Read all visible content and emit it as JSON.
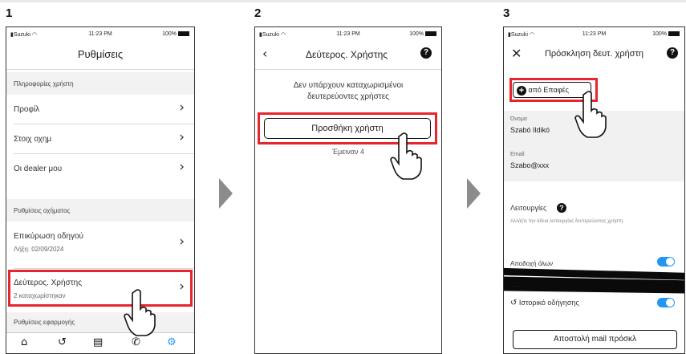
{
  "steps": [
    {
      "number": "1"
    },
    {
      "number": "2"
    },
    {
      "number": "3"
    }
  ],
  "status_bar": {
    "carrier": "Suzuki",
    "time": "11:23 PM",
    "battery": "100%"
  },
  "screen1": {
    "title": "Ρυθμίσεις",
    "section_user_info": "Πληροφορίες χρήστη",
    "profile": "Προφίλ",
    "vehicle_info": "Στοιχ οχημ",
    "my_dealers": "Οι dealer μου",
    "section_vehicle_settings": "Ρυθμίσεις οχήματος",
    "driver_verification": "Επικύρωση οδηγού",
    "driver_verification_expiry": "Λήξη: 02/09/2024",
    "secondary_user": "Δεύτερος. Χρήστης",
    "secondary_user_count": "2 καταχωρίστηκαν",
    "section_app_settings": "Ρυθμίσεις εφαρμογής",
    "tabs": [
      "home-icon",
      "history-icon",
      "map-icon",
      "phone-icon",
      "settings-icon"
    ]
  },
  "screen2": {
    "title": "Δεύτερος. Χρήστης",
    "no_users_msg": "Δεν υπάρχουν καταχωρισμένοι δευτερεύοντες χρήστες",
    "add_user_button": "Προσθήκη χρήστη",
    "remaining": "Έμειναν 4"
  },
  "screen3": {
    "title": "Πρόσκληση δευτ. χρήστη",
    "from_contacts_button": "από Επαφές",
    "name_label": "Όνομα",
    "name_value": "Szabó Ildikó",
    "email_label": "Email",
    "email_value": "Szabo@xxx",
    "functions_label": "Λειτουργίες",
    "functions_hint": "Αλλάξτε την άδεια λειτουργίας δευτερεύοντος χρήστη.",
    "accept_all": "Αποδοχή όλων",
    "drive_history": "Ιστορικό οδήγησης",
    "send_mail_button": "Αποστολή mail πρόσκλ"
  },
  "colors": {
    "highlight": "#e8252d",
    "accent": "#2196f3",
    "arrow": "#8c8c8c"
  }
}
